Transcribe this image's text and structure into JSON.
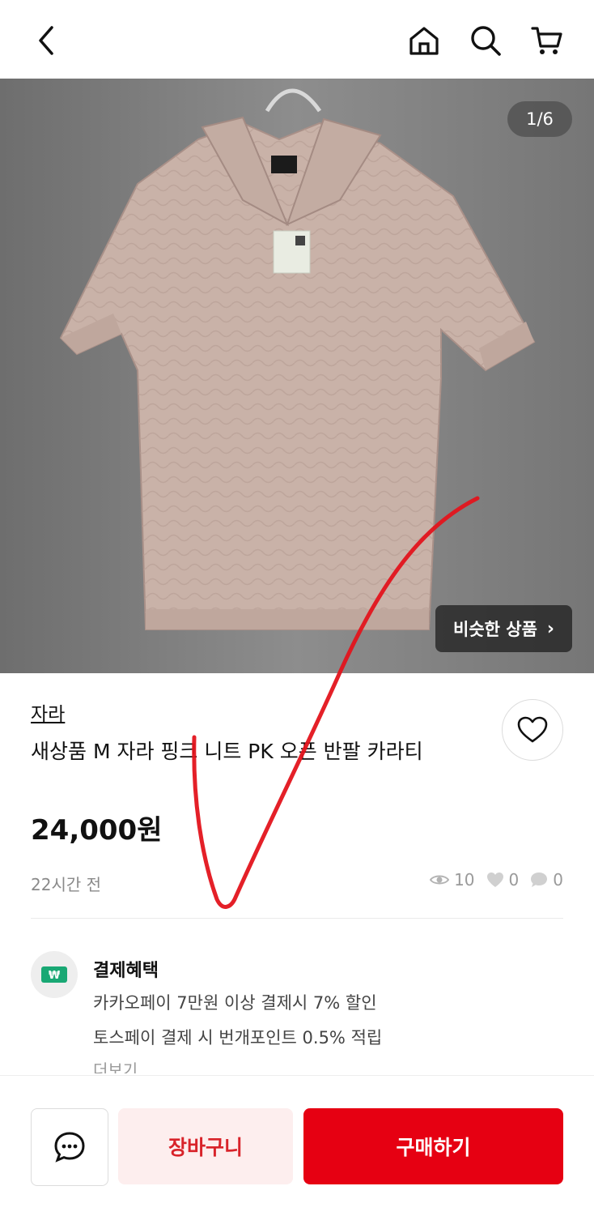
{
  "header": {
    "back_icon": "chevron-left-icon",
    "home_icon": "home-icon",
    "search_icon": "search-icon",
    "cart_icon": "cart-icon"
  },
  "image": {
    "counter": "1/6",
    "similar_label": "비슷한 상품",
    "similar_chevron": "›"
  },
  "product": {
    "brand": "자라",
    "title": "새상품 M 자라 핑크 니트 PK 오픈 반팔 카라티",
    "price": "24,000원",
    "time_ago": "22시간 전",
    "views": "10",
    "likes": "0",
    "chats": "0"
  },
  "benefits": {
    "title": "결제혜택",
    "line1": "카카오페이 7만원 이상 결제시 7% 할인",
    "line2": "토스페이 결제 시 번개포인트 0.5% 적립",
    "more": "더보기"
  },
  "actions": {
    "cart_label": "장바구니",
    "buy_label": "구매하기"
  },
  "colors": {
    "primary": "#e60012",
    "cart_bg": "#fdeeee",
    "cart_text": "#d8232a"
  }
}
